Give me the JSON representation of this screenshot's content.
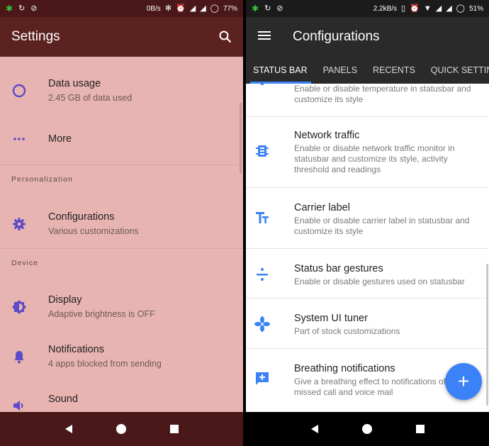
{
  "left": {
    "statusbar": {
      "speed": "0B/s",
      "battery": "77%"
    },
    "appbar": {
      "title": "Settings"
    },
    "items": [
      {
        "title": "Data usage",
        "subtitle": "2.45 GB of data used",
        "icon": "data-usage-icon"
      },
      {
        "title": "More",
        "subtitle": "",
        "icon": "more-dots-icon"
      },
      {
        "title": "Configurations",
        "subtitle": "Various customizations",
        "icon": "gear-icon"
      },
      {
        "title": "Display",
        "subtitle": "Adaptive brightness is OFF",
        "icon": "brightness-icon"
      },
      {
        "title": "Notifications",
        "subtitle": "4 apps blocked from sending",
        "icon": "bell-icon"
      },
      {
        "title": "Sound",
        "subtitle": "",
        "icon": "speaker-icon"
      }
    ],
    "sections": {
      "personalization": "Personalization",
      "device": "Device"
    }
  },
  "right": {
    "statusbar": {
      "speed": "2.2kB/s",
      "battery": "51%"
    },
    "appbar": {
      "title": "Configurations"
    },
    "tabs": [
      "STATUS BAR",
      "PANELS",
      "RECENTS",
      "QUICK SETTINGS"
    ],
    "partial_subtitle": "Enable or disable temperature in statusbar and customize its style",
    "items": [
      {
        "title": "Network traffic",
        "subtitle": "Enable or disable network traffic monitor in statusbar and customize its style, activity threshold and readings",
        "icon": "network-traffic-icon"
      },
      {
        "title": "Carrier label",
        "subtitle": "Enable or disable carrier label in statusbar and customize its style",
        "icon": "text-format-icon"
      },
      {
        "title": "Status bar gestures",
        "subtitle": "Enable or disable gestures used on statusbar",
        "icon": "gesture-icon"
      },
      {
        "title": "System UI tuner",
        "subtitle": "Part of stock customizations",
        "icon": "fan-icon"
      },
      {
        "title": "Breathing notifications",
        "subtitle": "Give a breathing effect to notifications of SMS, missed call and voice mail",
        "icon": "message-plus-icon"
      }
    ],
    "fab": {
      "label": "+"
    }
  },
  "colors": {
    "left_background": "#e8b4b1",
    "left_appbar": "#5b221f",
    "accent_blue": "#3b82f6",
    "icon_purple": "#5c4ac9"
  }
}
